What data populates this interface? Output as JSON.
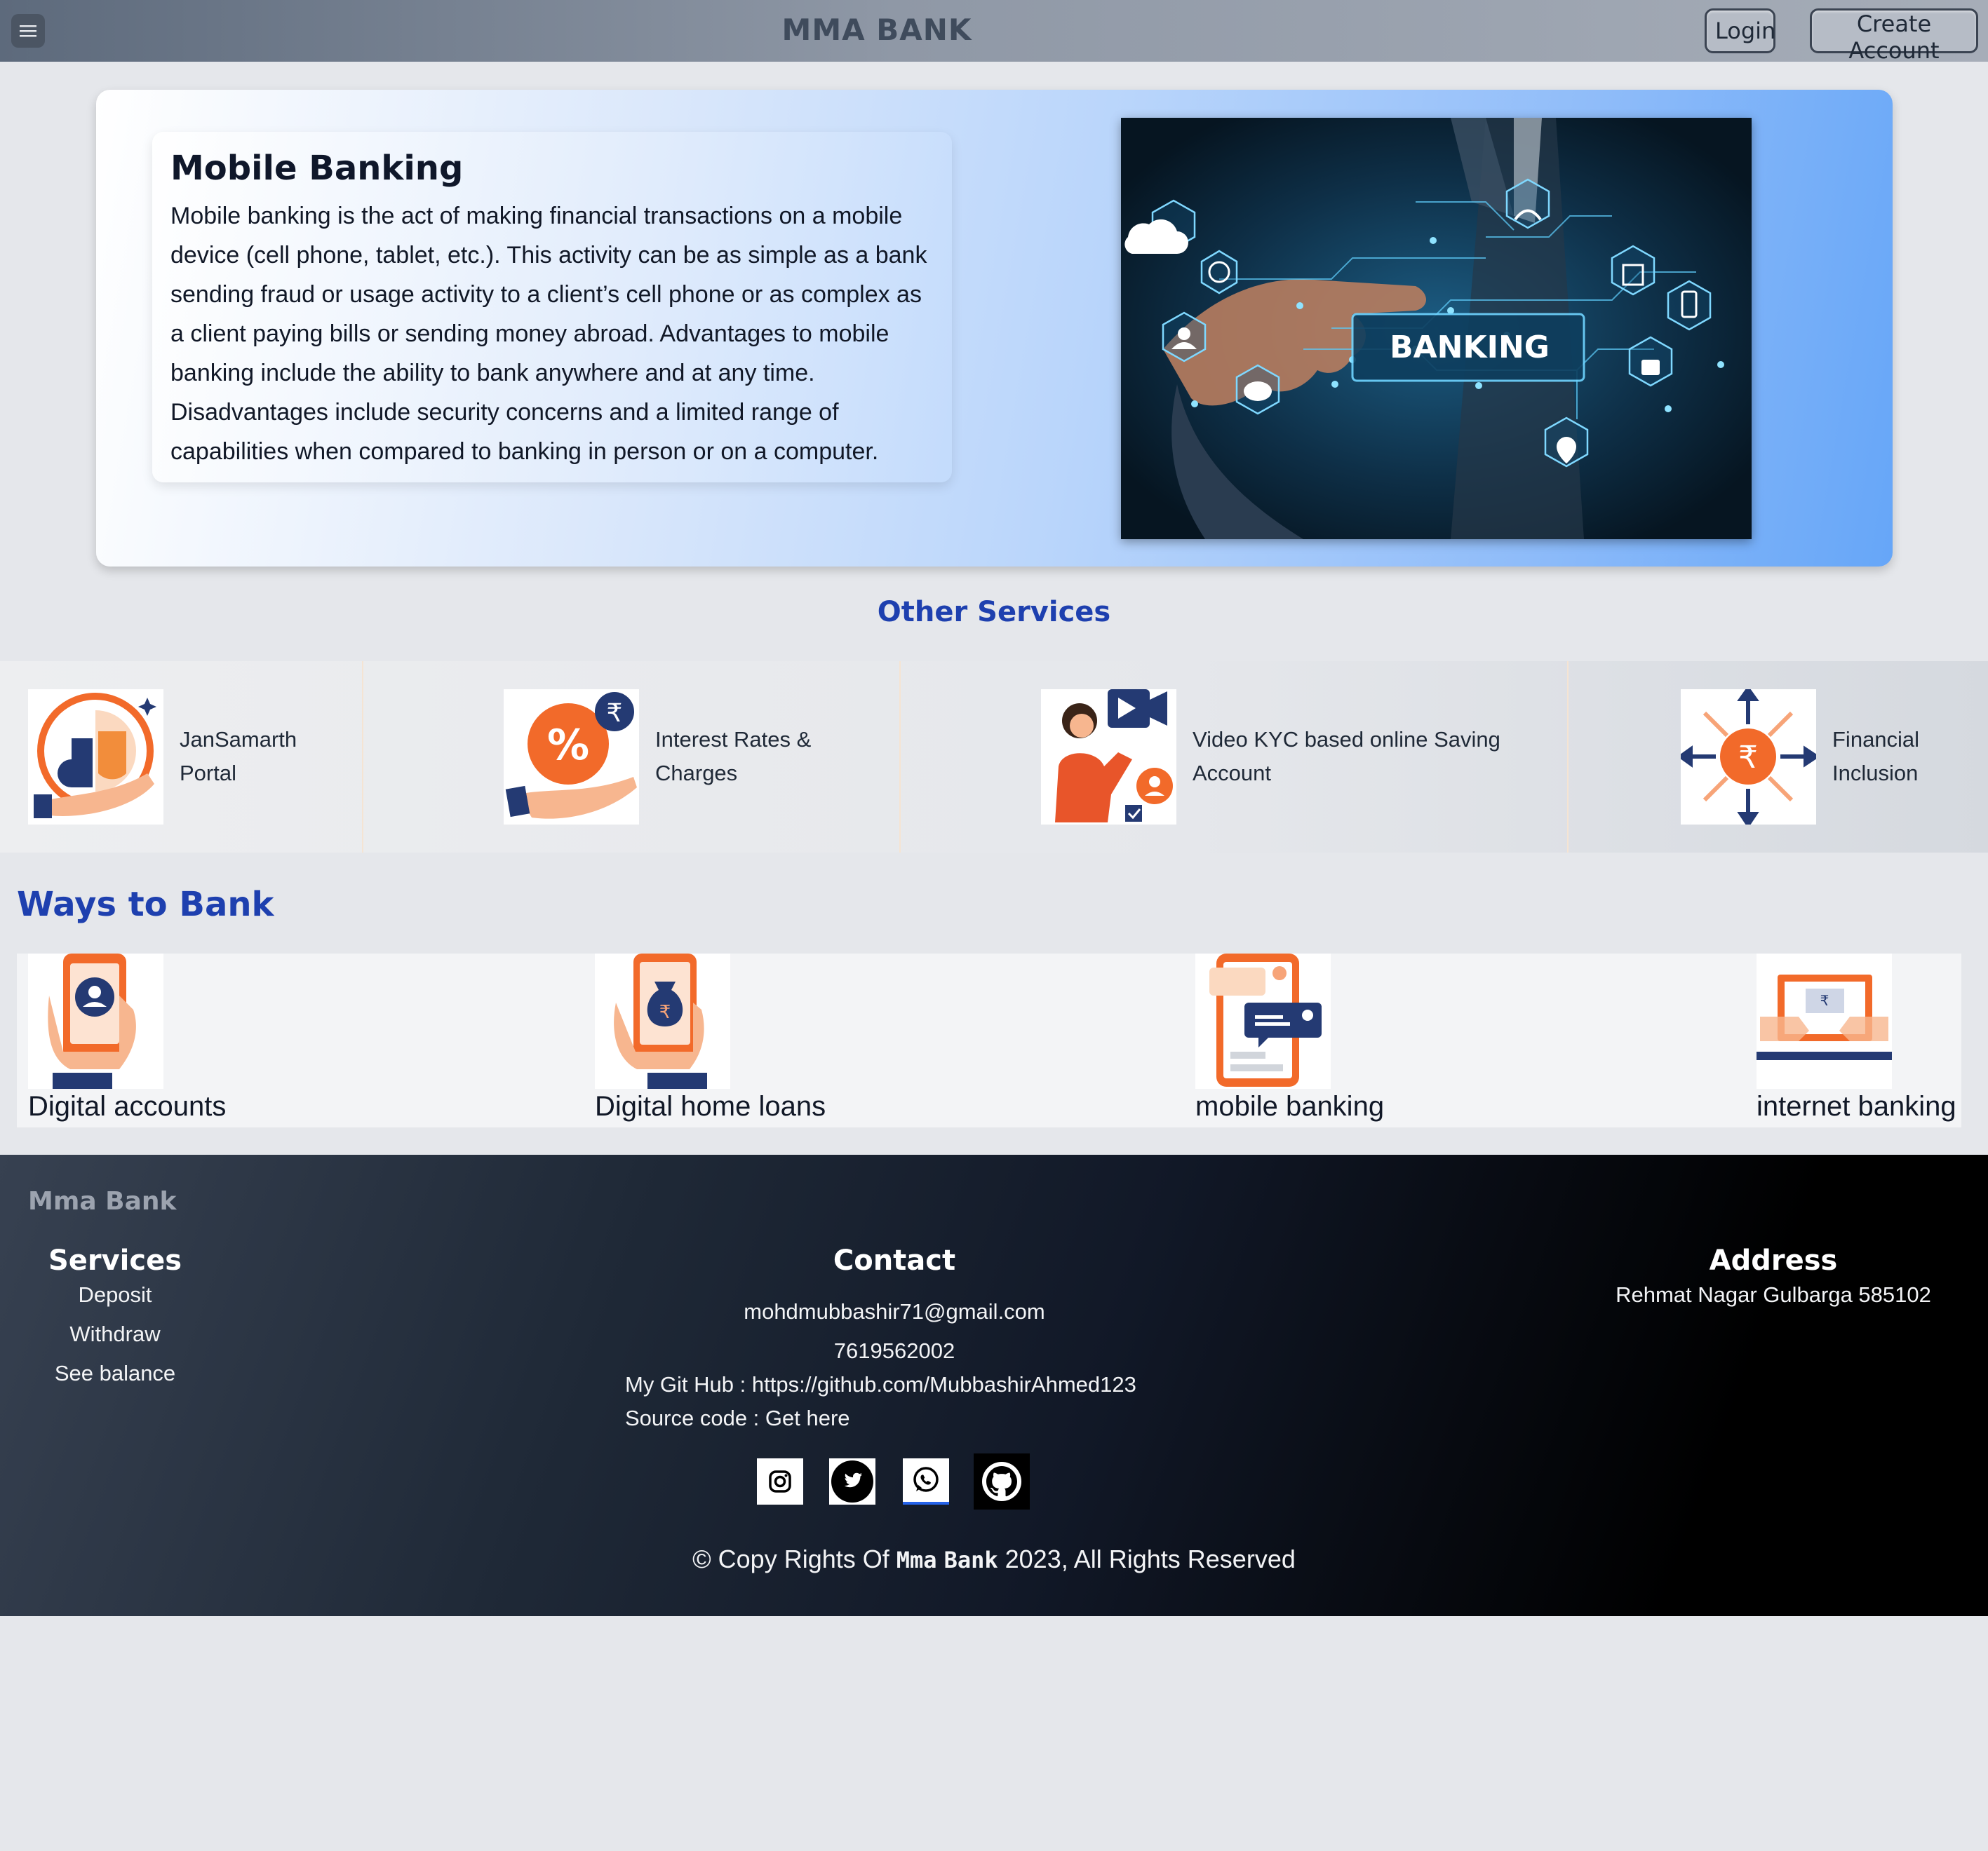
{
  "navbar": {
    "menu_icon": "hamburger-menu-icon",
    "brand": "MMA BANK",
    "login": "Login",
    "create_account": "Create Account"
  },
  "hero": {
    "title": "Mobile Banking",
    "body": "Mobile banking is the act of making financial transactions on a mobile device (cell phone, tablet, etc.). This activity can be as simple as a bank sending fraud or usage activity to a client’s cell phone or as complex as a client paying bills or sending money abroad. Advantages to mobile banking include the ability to bank anywhere and at any time. Disadvantages include security concerns and a limited range of capabilities when compared to banking in person or on a computer.",
    "image_text": "BANKING"
  },
  "other_services": {
    "title": "Other Services",
    "items": [
      {
        "label_line1": "JanSamarth",
        "label_line2": "Portal",
        "icon": "jansamarth-portal-icon"
      },
      {
        "label_line1": "Interest Rates &",
        "label_line2": "Charges",
        "icon": "interest-rates-icon"
      },
      {
        "label_line1": "Video KYC based online Saving",
        "label_line2": "Account",
        "icon": "video-kyc-icon"
      },
      {
        "label_line1": "Financial",
        "label_line2": "Inclusion",
        "icon": "financial-inclusion-icon"
      }
    ]
  },
  "ways_to_bank": {
    "title": "Ways to Bank",
    "items": [
      {
        "label": "Digital accounts",
        "icon": "digital-accounts-icon"
      },
      {
        "label": "Digital home loans",
        "icon": "digital-home-loans-icon"
      },
      {
        "label": "mobile banking",
        "icon": "mobile-banking-icon"
      },
      {
        "label": "internet banking",
        "icon": "internet-banking-icon"
      }
    ]
  },
  "footer": {
    "brand": "Mma Bank",
    "services": {
      "title": "Services",
      "items": [
        "Deposit",
        "Withdraw",
        "See balance"
      ]
    },
    "contact": {
      "title": "Contact",
      "email": "mohdmubbashir71@gmail.com",
      "phone": "7619562002",
      "github": "My Git Hub : https://github.com/MubbashirAhmed123",
      "source": "Source code : Get here"
    },
    "address": {
      "title": "Address",
      "line": "Rehmat Nagar Gulbarga 585102"
    },
    "social_icons": [
      "instagram-icon",
      "twitter-icon",
      "whatsapp-icon",
      "github-icon"
    ],
    "copyright_prefix": "© Copy Rights Of ",
    "copyright_brand1": "Mma",
    "copyright_brand2": "Bank",
    "copyright_suffix": " 2023, All Rights Reserved"
  },
  "colors": {
    "accent_blue": "#1e40af",
    "orange": "#f26a2a",
    "navy": "#243a73"
  }
}
